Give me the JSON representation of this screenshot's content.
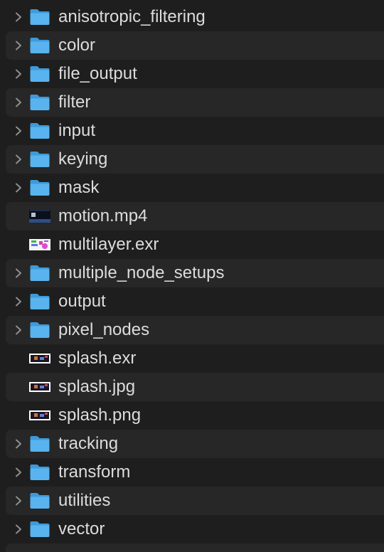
{
  "file_list": {
    "items": [
      {
        "name": "anisotropic_filtering",
        "kind": "folder",
        "icon": "folder-icon"
      },
      {
        "name": "color",
        "kind": "folder",
        "icon": "folder-icon"
      },
      {
        "name": "file_output",
        "kind": "folder",
        "icon": "folder-icon"
      },
      {
        "name": "filter",
        "kind": "folder",
        "icon": "folder-icon"
      },
      {
        "name": "input",
        "kind": "folder",
        "icon": "folder-icon"
      },
      {
        "name": "keying",
        "kind": "folder",
        "icon": "folder-icon"
      },
      {
        "name": "mask",
        "kind": "folder",
        "icon": "folder-icon"
      },
      {
        "name": "motion.mp4",
        "kind": "file",
        "icon": "video-thumbnail-icon"
      },
      {
        "name": "multilayer.exr",
        "kind": "file",
        "icon": "image-thumbnail-icon"
      },
      {
        "name": "multiple_node_setups",
        "kind": "folder",
        "icon": "folder-icon"
      },
      {
        "name": "output",
        "kind": "folder",
        "icon": "folder-icon"
      },
      {
        "name": "pixel_nodes",
        "kind": "folder",
        "icon": "folder-icon"
      },
      {
        "name": "splash.exr",
        "kind": "file",
        "icon": "image-thumbnail-icon"
      },
      {
        "name": "splash.jpg",
        "kind": "file",
        "icon": "image-thumbnail-icon"
      },
      {
        "name": "splash.png",
        "kind": "file",
        "icon": "image-thumbnail-icon"
      },
      {
        "name": "tracking",
        "kind": "folder",
        "icon": "folder-icon"
      },
      {
        "name": "transform",
        "kind": "folder",
        "icon": "folder-icon"
      },
      {
        "name": "utilities",
        "kind": "folder",
        "icon": "folder-icon"
      },
      {
        "name": "vector",
        "kind": "folder",
        "icon": "folder-icon"
      }
    ]
  },
  "colors": {
    "background": "#1e1e1e",
    "row_alternate": "#272727",
    "text": "#dcdcdc",
    "chevron": "#8e8e8e",
    "folder_front": "#58b3ee",
    "folder_back": "#3e9ad9"
  }
}
